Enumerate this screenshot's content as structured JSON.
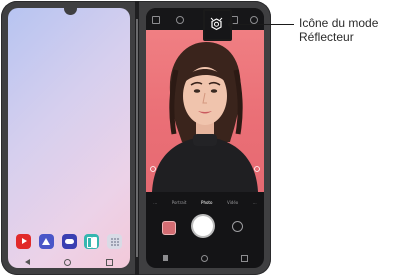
{
  "callout": {
    "line1": "Icône du mode",
    "line2": "Réflecteur"
  },
  "camera": {
    "modes": [
      "...",
      "Portrait",
      "Photo",
      "Vidéo",
      "..."
    ],
    "active_mode": "Photo"
  },
  "left_screen": {
    "dock_apps": [
      "youtube-icon",
      "gallery-icon",
      "game-icon",
      "dual-screen-icon",
      "apps-grid-icon"
    ]
  },
  "icons": {
    "flash_mode": "reflector-mode-icon"
  },
  "colors": {
    "device": "#3f3f41",
    "viewfinder_background": "#ea6f76",
    "wallpaper_start": "#b7c4f1",
    "wallpaper_end": "#f3c9d9"
  }
}
